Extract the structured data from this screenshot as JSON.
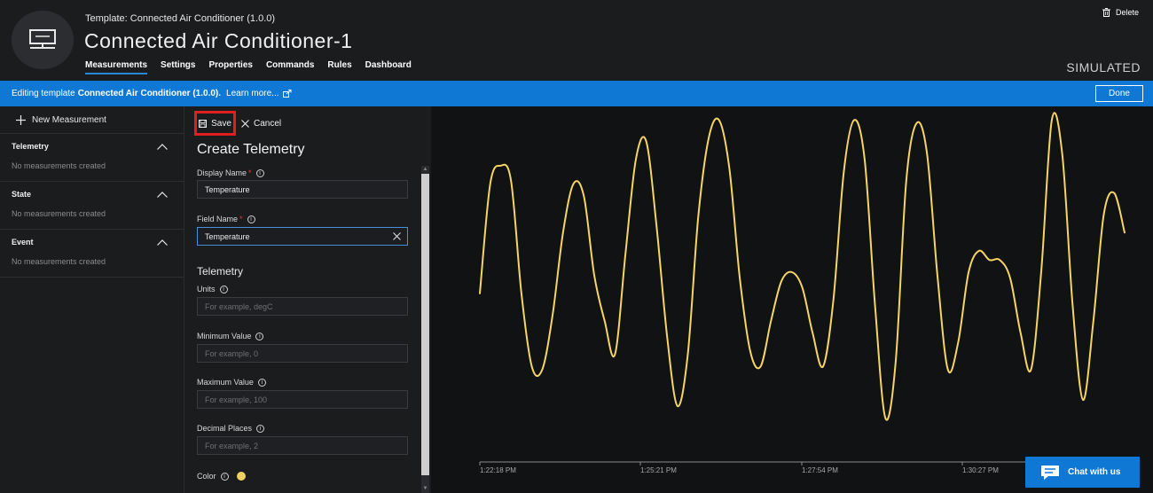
{
  "header": {
    "template_prefix": "Template:",
    "template_name": "Connected Air Conditioner",
    "template_version": "(1.0.0)",
    "device_title": "Connected Air Conditioner-1",
    "tabs": [
      {
        "label": "Measurements",
        "active": true
      },
      {
        "label": "Settings",
        "active": false
      },
      {
        "label": "Properties",
        "active": false
      },
      {
        "label": "Commands",
        "active": false
      },
      {
        "label": "Rules",
        "active": false
      },
      {
        "label": "Dashboard",
        "active": false
      }
    ],
    "delete_label": "Delete",
    "simulated_label": "SIMULATED",
    "avatar_icon": "monitor-icon"
  },
  "banner": {
    "prefix": "Editing template",
    "template": "Connected Air Conditioner (1.0.0).",
    "learn_more": "Learn more...",
    "done_label": "Done",
    "color": "#0f78d4"
  },
  "sidebar": {
    "new_measurement_label": "New Measurement",
    "sections": [
      {
        "title": "Telemetry",
        "empty_text": "No measurements created"
      },
      {
        "title": "State",
        "empty_text": "No measurements created"
      },
      {
        "title": "Event",
        "empty_text": "No measurements created"
      }
    ]
  },
  "form": {
    "save_label": "Save",
    "cancel_label": "Cancel",
    "title": "Create Telemetry",
    "display_name_label": "Display Name",
    "display_name_value": "Temperature",
    "field_name_label": "Field Name",
    "field_name_value": "Temperature",
    "telemetry_heading": "Telemetry",
    "units_label": "Units",
    "units_placeholder": "For example, degC",
    "min_label": "Minimum Value",
    "min_placeholder": "For example, 0",
    "max_label": "Maximum Value",
    "max_placeholder": "For example, 100",
    "decimal_label": "Decimal Places",
    "decimal_placeholder": "For example, 2",
    "color_label": "Color",
    "color_value": "#f0d060",
    "required_mark": "*"
  },
  "chart_data": {
    "type": "line",
    "series": [
      {
        "color": "#f5d565",
        "values": [
          0.42,
          0.78,
          0.84,
          0.79,
          0.42,
          0.18,
          0.17,
          0.35,
          0.62,
          0.78,
          0.74,
          0.48,
          0.33,
          0.22,
          0.55,
          0.86,
          0.92,
          0.64,
          0.28,
          0.05,
          0.22,
          0.67,
          0.93,
          0.99,
          0.83,
          0.47,
          0.23,
          0.18,
          0.33,
          0.46,
          0.49,
          0.44,
          0.29,
          0.18,
          0.4,
          0.82,
          0.99,
          0.86,
          0.38,
          0.01,
          0.2,
          0.79,
          0.98,
          0.88,
          0.48,
          0.17,
          0.26,
          0.49,
          0.56,
          0.53,
          0.53,
          0.47,
          0.29,
          0.17,
          0.5,
          0.99,
          0.88,
          0.38,
          0.07,
          0.33,
          0.68,
          0.75,
          0.62
        ]
      }
    ],
    "x_tick_labels": [
      "1:22:18 PM",
      "1:25:21 PM",
      "1:27:54 PM",
      "1:30:27 PM"
    ],
    "grid": false,
    "legend": "none"
  },
  "chat": {
    "label": "Chat with us",
    "icon": "chat-bubble-icon",
    "color": "#0f78d4"
  }
}
